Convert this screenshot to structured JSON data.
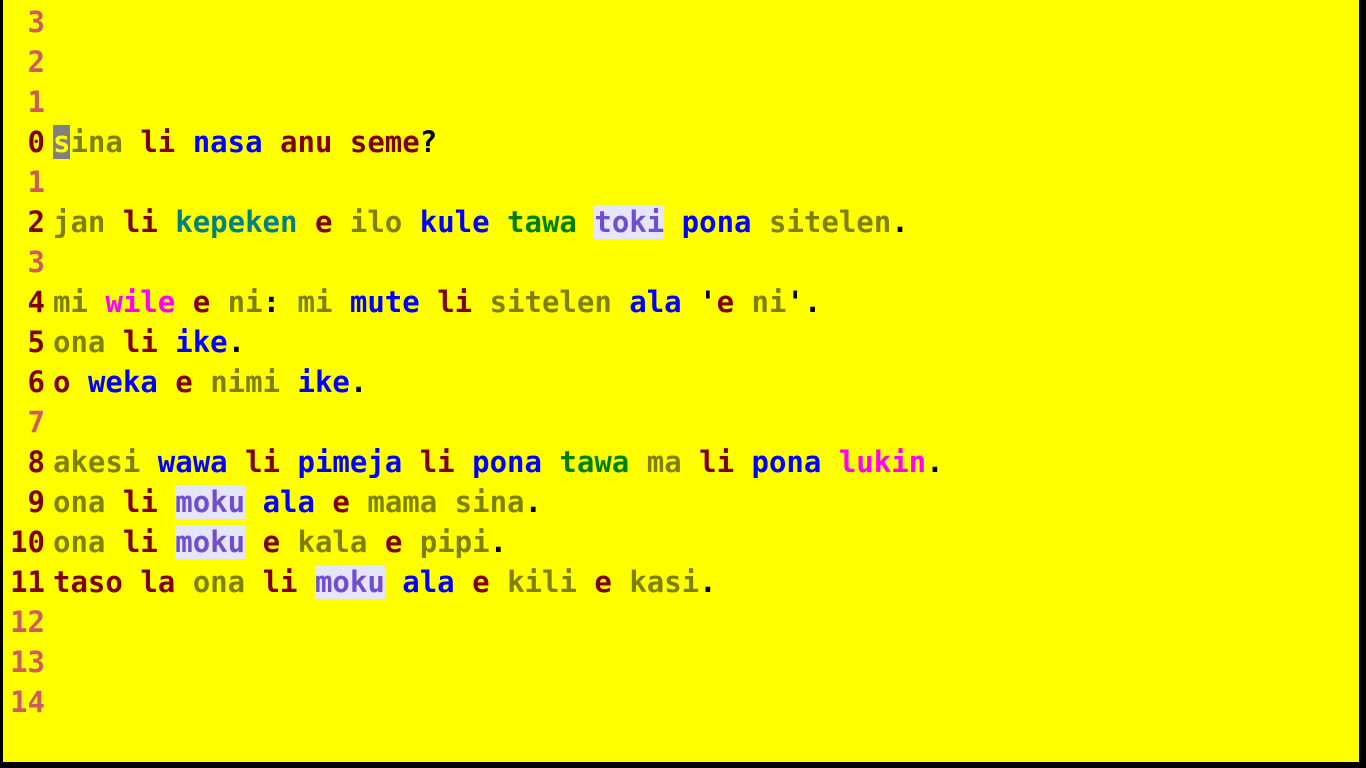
{
  "colors": {
    "background": "#ffff00",
    "border": "#000000"
  },
  "gutter": [
    {
      "n": "3",
      "style": "ln-light"
    },
    {
      "n": "2",
      "style": "ln-light"
    },
    {
      "n": "1",
      "style": "ln-light"
    },
    {
      "n": "0",
      "style": "ln-dark"
    },
    {
      "n": "1",
      "style": "ln-light"
    },
    {
      "n": "2",
      "style": "ln-dark"
    },
    {
      "n": "3",
      "style": "ln-light"
    },
    {
      "n": "4",
      "style": "ln-dark"
    },
    {
      "n": "5",
      "style": "ln-dark"
    },
    {
      "n": "6",
      "style": "ln-dark"
    },
    {
      "n": "7",
      "style": "ln-light"
    },
    {
      "n": "8",
      "style": "ln-dark"
    },
    {
      "n": "9",
      "style": "ln-dark"
    },
    {
      "n": "10",
      "style": "ln-dark"
    },
    {
      "n": "11",
      "style": "ln-dark"
    },
    {
      "n": "12",
      "style": "ln-light"
    },
    {
      "n": "13",
      "style": "ln-light"
    },
    {
      "n": "14",
      "style": "ln-light"
    }
  ],
  "lines": [
    [],
    [],
    [],
    [
      {
        "t": "s",
        "c": "cursor"
      },
      {
        "t": "ina",
        "c": "olive"
      },
      {
        "t": " ",
        "c": "black"
      },
      {
        "t": "li",
        "c": "darkred"
      },
      {
        "t": " ",
        "c": "black"
      },
      {
        "t": "nasa",
        "c": "blue"
      },
      {
        "t": " ",
        "c": "black"
      },
      {
        "t": "anu",
        "c": "darkred"
      },
      {
        "t": " ",
        "c": "black"
      },
      {
        "t": "seme",
        "c": "darkred"
      },
      {
        "t": "?",
        "c": "black"
      }
    ],
    [],
    [
      {
        "t": "jan",
        "c": "olive"
      },
      {
        "t": " ",
        "c": "black"
      },
      {
        "t": "li",
        "c": "darkred"
      },
      {
        "t": " ",
        "c": "black"
      },
      {
        "t": "kepeken",
        "c": "teal"
      },
      {
        "t": " ",
        "c": "black"
      },
      {
        "t": "e",
        "c": "darkred"
      },
      {
        "t": " ",
        "c": "black"
      },
      {
        "t": "ilo",
        "c": "olive"
      },
      {
        "t": " ",
        "c": "black"
      },
      {
        "t": "kule",
        "c": "blue"
      },
      {
        "t": " ",
        "c": "black"
      },
      {
        "t": "tawa",
        "c": "green"
      },
      {
        "t": " ",
        "c": "black"
      },
      {
        "t": "toki",
        "c": "hl-moku"
      },
      {
        "t": " ",
        "c": "black"
      },
      {
        "t": "pona",
        "c": "blue"
      },
      {
        "t": " ",
        "c": "black"
      },
      {
        "t": "sitelen",
        "c": "olive"
      },
      {
        "t": ".",
        "c": "black"
      }
    ],
    [],
    [
      {
        "t": "mi",
        "c": "olive"
      },
      {
        "t": " ",
        "c": "black"
      },
      {
        "t": "wile",
        "c": "magenta"
      },
      {
        "t": " ",
        "c": "black"
      },
      {
        "t": "e",
        "c": "darkred"
      },
      {
        "t": " ",
        "c": "black"
      },
      {
        "t": "ni",
        "c": "olive"
      },
      {
        "t": ": ",
        "c": "black"
      },
      {
        "t": "mi",
        "c": "olive"
      },
      {
        "t": " ",
        "c": "black"
      },
      {
        "t": "mute",
        "c": "blue"
      },
      {
        "t": " ",
        "c": "black"
      },
      {
        "t": "li",
        "c": "darkred"
      },
      {
        "t": " ",
        "c": "black"
      },
      {
        "t": "sitelen",
        "c": "olive"
      },
      {
        "t": " ",
        "c": "black"
      },
      {
        "t": "ala",
        "c": "blue"
      },
      {
        "t": " '",
        "c": "black"
      },
      {
        "t": "e",
        "c": "darkred"
      },
      {
        "t": " ",
        "c": "black"
      },
      {
        "t": "ni",
        "c": "olive"
      },
      {
        "t": "'.",
        "c": "black"
      }
    ],
    [
      {
        "t": "ona",
        "c": "olive"
      },
      {
        "t": " ",
        "c": "black"
      },
      {
        "t": "li",
        "c": "darkred"
      },
      {
        "t": " ",
        "c": "black"
      },
      {
        "t": "ike",
        "c": "blue"
      },
      {
        "t": ".",
        "c": "black"
      }
    ],
    [
      {
        "t": "o",
        "c": "darkred"
      },
      {
        "t": " ",
        "c": "black"
      },
      {
        "t": "weka",
        "c": "blue"
      },
      {
        "t": " ",
        "c": "black"
      },
      {
        "t": "e",
        "c": "darkred"
      },
      {
        "t": " ",
        "c": "black"
      },
      {
        "t": "nimi",
        "c": "olive"
      },
      {
        "t": " ",
        "c": "black"
      },
      {
        "t": "ike",
        "c": "blue"
      },
      {
        "t": ".",
        "c": "black"
      }
    ],
    [],
    [
      {
        "t": "akesi",
        "c": "olive"
      },
      {
        "t": " ",
        "c": "black"
      },
      {
        "t": "wawa",
        "c": "blue"
      },
      {
        "t": " ",
        "c": "black"
      },
      {
        "t": "li",
        "c": "darkred"
      },
      {
        "t": " ",
        "c": "black"
      },
      {
        "t": "pimeja",
        "c": "blue"
      },
      {
        "t": " ",
        "c": "black"
      },
      {
        "t": "li",
        "c": "darkred"
      },
      {
        "t": " ",
        "c": "black"
      },
      {
        "t": "pona",
        "c": "blue"
      },
      {
        "t": " ",
        "c": "black"
      },
      {
        "t": "tawa",
        "c": "green"
      },
      {
        "t": " ",
        "c": "black"
      },
      {
        "t": "ma",
        "c": "olive"
      },
      {
        "t": " ",
        "c": "black"
      },
      {
        "t": "li",
        "c": "darkred"
      },
      {
        "t": " ",
        "c": "black"
      },
      {
        "t": "pona",
        "c": "blue"
      },
      {
        "t": " ",
        "c": "black"
      },
      {
        "t": "lukin",
        "c": "magenta"
      },
      {
        "t": ".",
        "c": "black"
      }
    ],
    [
      {
        "t": "ona",
        "c": "olive"
      },
      {
        "t": " ",
        "c": "black"
      },
      {
        "t": "li",
        "c": "darkred"
      },
      {
        "t": " ",
        "c": "black"
      },
      {
        "t": "moku",
        "c": "hl-moku"
      },
      {
        "t": " ",
        "c": "black"
      },
      {
        "t": "ala",
        "c": "blue"
      },
      {
        "t": " ",
        "c": "black"
      },
      {
        "t": "e",
        "c": "darkred"
      },
      {
        "t": " ",
        "c": "black"
      },
      {
        "t": "mama",
        "c": "olive"
      },
      {
        "t": " ",
        "c": "black"
      },
      {
        "t": "sina",
        "c": "olive"
      },
      {
        "t": ".",
        "c": "black"
      }
    ],
    [
      {
        "t": "ona",
        "c": "olive"
      },
      {
        "t": " ",
        "c": "black"
      },
      {
        "t": "li",
        "c": "darkred"
      },
      {
        "t": " ",
        "c": "black"
      },
      {
        "t": "moku",
        "c": "hl-moku"
      },
      {
        "t": " ",
        "c": "black"
      },
      {
        "t": "e",
        "c": "darkred"
      },
      {
        "t": " ",
        "c": "black"
      },
      {
        "t": "kala",
        "c": "olive"
      },
      {
        "t": " ",
        "c": "black"
      },
      {
        "t": "e",
        "c": "darkred"
      },
      {
        "t": " ",
        "c": "black"
      },
      {
        "t": "pipi",
        "c": "olive"
      },
      {
        "t": ".",
        "c": "black"
      }
    ],
    [
      {
        "t": "taso",
        "c": "darkred"
      },
      {
        "t": " ",
        "c": "black"
      },
      {
        "t": "la",
        "c": "darkred"
      },
      {
        "t": " ",
        "c": "black"
      },
      {
        "t": "ona",
        "c": "olive"
      },
      {
        "t": " ",
        "c": "black"
      },
      {
        "t": "li",
        "c": "darkred"
      },
      {
        "t": " ",
        "c": "black"
      },
      {
        "t": "moku",
        "c": "hl-moku"
      },
      {
        "t": " ",
        "c": "black"
      },
      {
        "t": "ala",
        "c": "blue"
      },
      {
        "t": " ",
        "c": "black"
      },
      {
        "t": "e",
        "c": "darkred"
      },
      {
        "t": " ",
        "c": "black"
      },
      {
        "t": "kili",
        "c": "olive"
      },
      {
        "t": " ",
        "c": "black"
      },
      {
        "t": "e",
        "c": "darkred"
      },
      {
        "t": " ",
        "c": "black"
      },
      {
        "t": "kasi",
        "c": "olive"
      },
      {
        "t": ".",
        "c": "black"
      }
    ],
    [],
    [],
    []
  ]
}
